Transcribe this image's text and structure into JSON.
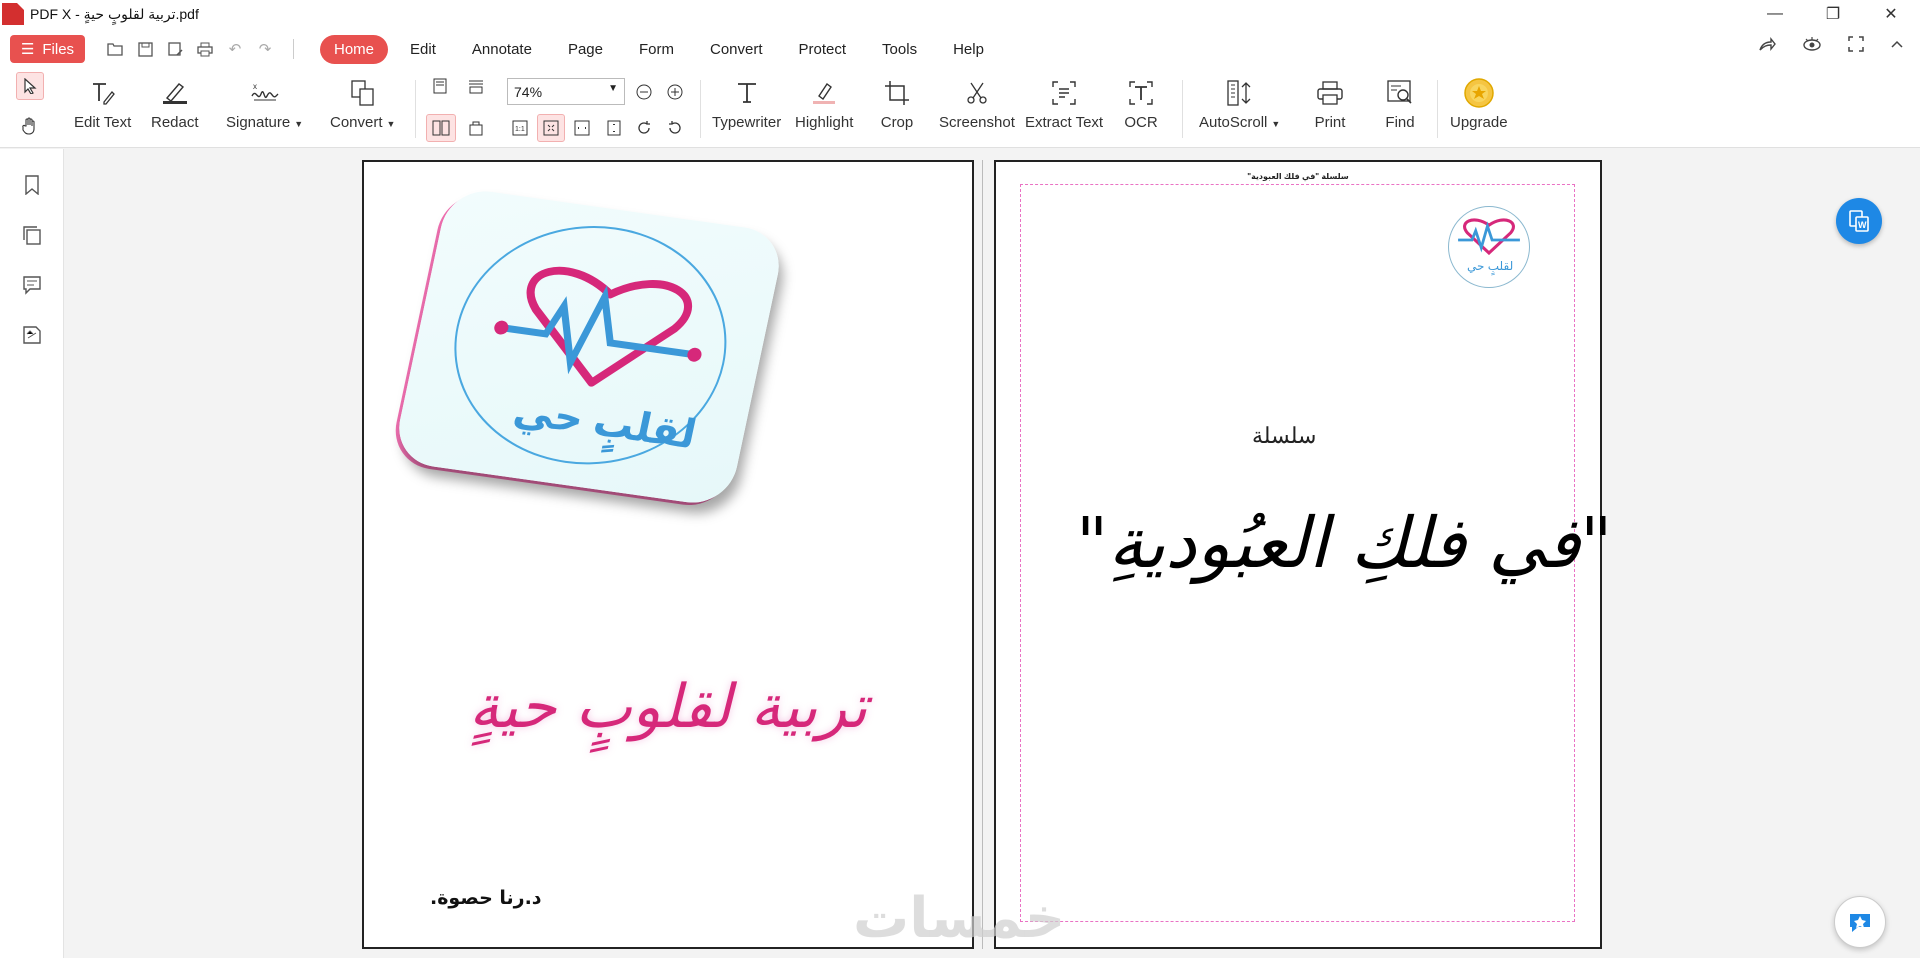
{
  "window": {
    "title": "PDF X - تربية لقلوبٍ حيةٍ.pdf",
    "controls": {
      "minimize": "—",
      "restore": "❐",
      "close": "✕"
    }
  },
  "menubar": {
    "files_label": "Files",
    "tabs": [
      "Home",
      "Edit",
      "Annotate",
      "Page",
      "Form",
      "Convert",
      "Protect",
      "Tools",
      "Help"
    ],
    "active_tab": "Home"
  },
  "ribbon": {
    "edit_text": "Edit Text",
    "redact": "Redact",
    "signature": "Signature",
    "convert": "Convert",
    "zoom": "74%",
    "typewriter": "Typewriter",
    "highlight": "Highlight",
    "crop": "Crop",
    "screenshot": "Screenshot",
    "extract_text": "Extract Text",
    "ocr": "OCR",
    "autoscroll": "AutoScroll",
    "print": "Print",
    "find": "Find",
    "upgrade": "Upgrade"
  },
  "document": {
    "left_page": {
      "logo_text": "لقلبٍ حي",
      "title": "تربية لقلوبٍ حيةٍ",
      "author": "د.رنا حصوة."
    },
    "right_page": {
      "header": "سلسلة \"في فلك العبودية\"",
      "logo_text": "لقلبٍ حي",
      "series": "سلسلة",
      "title": "\"في فلكِ العبُوديةِ\""
    },
    "watermark": "خمسات"
  },
  "colors": {
    "accent": "#e8514f",
    "logo_magenta": "#d6287a",
    "logo_blue": "#4aa8e0",
    "fab_blue": "#1e88e5"
  }
}
